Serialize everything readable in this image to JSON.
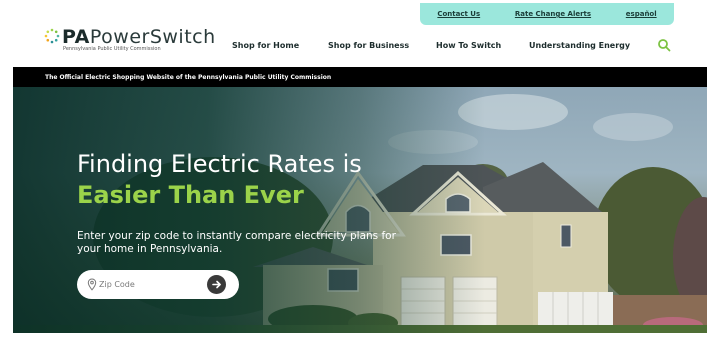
{
  "utility": {
    "contact": "Contact Us",
    "rate_alerts": "Rate Change Alerts",
    "espanol": "español"
  },
  "logo": {
    "pa": "PA",
    "name": "PowerSwitch",
    "sub": "Pennsylvania Public Utility Commission"
  },
  "nav": {
    "items": [
      {
        "label": "Shop for Home"
      },
      {
        "label": "Shop for Business"
      },
      {
        "label": "How To Switch"
      },
      {
        "label": "Understanding Energy"
      }
    ]
  },
  "tagline": "The Official Electric Shopping Website of the Pennsylvania Public Utility Commission",
  "hero": {
    "title_line1": "Finding Electric Rates is",
    "title_line2": "Easier Than Ever",
    "description": "Enter your zip code to instantly compare electricity plans for your home in Pennsylvania.",
    "zip_placeholder": "Zip Code"
  },
  "colors": {
    "accent_green": "#9bd34a",
    "util_bar": "#9be7dc",
    "overlay": "#0c372d"
  },
  "icons": {
    "search": "search-icon",
    "pin": "location-pin-icon",
    "go": "arrow-right-icon",
    "logo": "dots-circle-icon"
  }
}
